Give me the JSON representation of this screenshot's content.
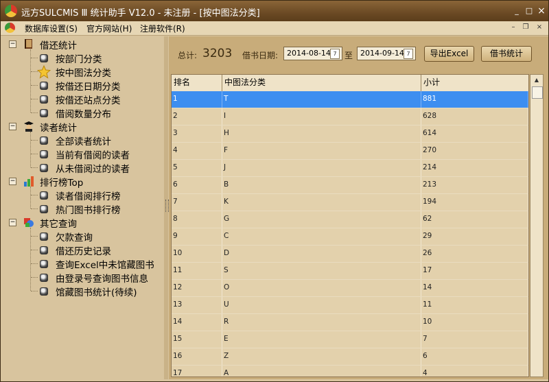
{
  "window": {
    "title": "远方SULCMIS Ⅲ 统计助手 V12.0 - 未注册 - [按中图法分类]",
    "min": "_",
    "max": "□",
    "close": "×"
  },
  "menu": {
    "items": [
      "数据库设置(S)",
      "官方网站(H)",
      "注册软件(R)"
    ],
    "mdi_min": "–",
    "mdi_restore": "❐",
    "mdi_close": "×"
  },
  "tree": {
    "groups": [
      {
        "label": "借还统计",
        "icon": "book-icon",
        "expander": "−",
        "children": [
          "按部门分类",
          "按中图法分类",
          "按借还日期分类",
          "按借还站点分类",
          "借阅数量分布"
        ]
      },
      {
        "label": "读者统计",
        "icon": "reader-icon",
        "expander": "−",
        "children": [
          "全部读者统计",
          "当前有借阅的读者",
          "从未借阅过的读者"
        ]
      },
      {
        "label": "排行榜Top",
        "icon": "chart-icon",
        "expander": "−",
        "children": [
          "读者借阅排行榜",
          "热门图书排行榜"
        ]
      },
      {
        "label": "其它查询",
        "icon": "query-icon",
        "expander": "−",
        "children": [
          "欠款查询",
          "借还历史记录",
          "查询Excel中未馆藏图书",
          "由登录号查询图书信息",
          "馆藏图书统计(待续)"
        ]
      }
    ],
    "selected": "按中图法分类"
  },
  "toolbar": {
    "total_label": "总计:",
    "total_value": "3203",
    "date_label": "借书日期:",
    "date_from": "2014-08-14",
    "to_label": "至",
    "date_to": "2014-09-14",
    "calendar_glyph": "7",
    "export_label": "导出Excel",
    "stats_label": "借书统计"
  },
  "grid": {
    "columns": [
      "排名",
      "中图法分类",
      "小计"
    ],
    "rows": [
      [
        "1",
        "T",
        "881"
      ],
      [
        "2",
        "I",
        "628"
      ],
      [
        "3",
        "H",
        "614"
      ],
      [
        "4",
        "F",
        "270"
      ],
      [
        "5",
        "J",
        "214"
      ],
      [
        "6",
        "B",
        "213"
      ],
      [
        "7",
        "K",
        "194"
      ],
      [
        "8",
        "G",
        "62"
      ],
      [
        "9",
        "C",
        "29"
      ],
      [
        "10",
        "D",
        "26"
      ],
      [
        "11",
        "S",
        "17"
      ],
      [
        "12",
        "O",
        "14"
      ],
      [
        "13",
        "U",
        "11"
      ],
      [
        "14",
        "R",
        "10"
      ],
      [
        "15",
        "E",
        "7"
      ],
      [
        "16",
        "Z",
        "6"
      ],
      [
        "17",
        "A",
        "4"
      ]
    ],
    "selected_row": 0,
    "scroll_up": "▲"
  }
}
